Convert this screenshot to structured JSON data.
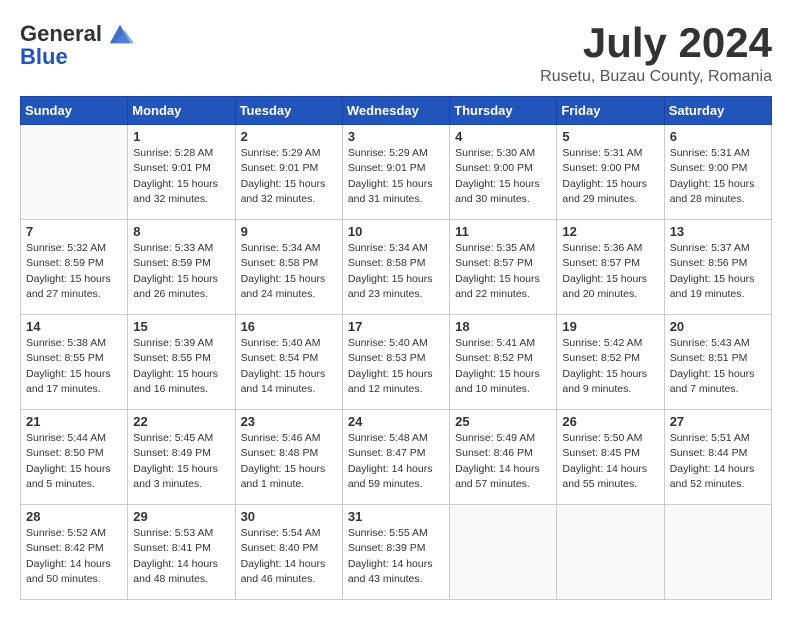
{
  "logo": {
    "general": "General",
    "blue": "Blue"
  },
  "title": "July 2024",
  "subtitle": "Rusetu, Buzau County, Romania",
  "weekdays": [
    "Sunday",
    "Monday",
    "Tuesday",
    "Wednesday",
    "Thursday",
    "Friday",
    "Saturday"
  ],
  "weeks": [
    [
      {
        "day": null,
        "info": null
      },
      {
        "day": "1",
        "sunrise": "5:28 AM",
        "sunset": "9:01 PM",
        "daylight": "15 hours and 32 minutes."
      },
      {
        "day": "2",
        "sunrise": "5:29 AM",
        "sunset": "9:01 PM",
        "daylight": "15 hours and 32 minutes."
      },
      {
        "day": "3",
        "sunrise": "5:29 AM",
        "sunset": "9:01 PM",
        "daylight": "15 hours and 31 minutes."
      },
      {
        "day": "4",
        "sunrise": "5:30 AM",
        "sunset": "9:00 PM",
        "daylight": "15 hours and 30 minutes."
      },
      {
        "day": "5",
        "sunrise": "5:31 AM",
        "sunset": "9:00 PM",
        "daylight": "15 hours and 29 minutes."
      },
      {
        "day": "6",
        "sunrise": "5:31 AM",
        "sunset": "9:00 PM",
        "daylight": "15 hours and 28 minutes."
      }
    ],
    [
      {
        "day": "7",
        "sunrise": "5:32 AM",
        "sunset": "8:59 PM",
        "daylight": "15 hours and 27 minutes."
      },
      {
        "day": "8",
        "sunrise": "5:33 AM",
        "sunset": "8:59 PM",
        "daylight": "15 hours and 26 minutes."
      },
      {
        "day": "9",
        "sunrise": "5:34 AM",
        "sunset": "8:58 PM",
        "daylight": "15 hours and 24 minutes."
      },
      {
        "day": "10",
        "sunrise": "5:34 AM",
        "sunset": "8:58 PM",
        "daylight": "15 hours and 23 minutes."
      },
      {
        "day": "11",
        "sunrise": "5:35 AM",
        "sunset": "8:57 PM",
        "daylight": "15 hours and 22 minutes."
      },
      {
        "day": "12",
        "sunrise": "5:36 AM",
        "sunset": "8:57 PM",
        "daylight": "15 hours and 20 minutes."
      },
      {
        "day": "13",
        "sunrise": "5:37 AM",
        "sunset": "8:56 PM",
        "daylight": "15 hours and 19 minutes."
      }
    ],
    [
      {
        "day": "14",
        "sunrise": "5:38 AM",
        "sunset": "8:55 PM",
        "daylight": "15 hours and 17 minutes."
      },
      {
        "day": "15",
        "sunrise": "5:39 AM",
        "sunset": "8:55 PM",
        "daylight": "15 hours and 16 minutes."
      },
      {
        "day": "16",
        "sunrise": "5:40 AM",
        "sunset": "8:54 PM",
        "daylight": "15 hours and 14 minutes."
      },
      {
        "day": "17",
        "sunrise": "5:40 AM",
        "sunset": "8:53 PM",
        "daylight": "15 hours and 12 minutes."
      },
      {
        "day": "18",
        "sunrise": "5:41 AM",
        "sunset": "8:52 PM",
        "daylight": "15 hours and 10 minutes."
      },
      {
        "day": "19",
        "sunrise": "5:42 AM",
        "sunset": "8:52 PM",
        "daylight": "15 hours and 9 minutes."
      },
      {
        "day": "20",
        "sunrise": "5:43 AM",
        "sunset": "8:51 PM",
        "daylight": "15 hours and 7 minutes."
      }
    ],
    [
      {
        "day": "21",
        "sunrise": "5:44 AM",
        "sunset": "8:50 PM",
        "daylight": "15 hours and 5 minutes."
      },
      {
        "day": "22",
        "sunrise": "5:45 AM",
        "sunset": "8:49 PM",
        "daylight": "15 hours and 3 minutes."
      },
      {
        "day": "23",
        "sunrise": "5:46 AM",
        "sunset": "8:48 PM",
        "daylight": "15 hours and 1 minute."
      },
      {
        "day": "24",
        "sunrise": "5:48 AM",
        "sunset": "8:47 PM",
        "daylight": "14 hours and 59 minutes."
      },
      {
        "day": "25",
        "sunrise": "5:49 AM",
        "sunset": "8:46 PM",
        "daylight": "14 hours and 57 minutes."
      },
      {
        "day": "26",
        "sunrise": "5:50 AM",
        "sunset": "8:45 PM",
        "daylight": "14 hours and 55 minutes."
      },
      {
        "day": "27",
        "sunrise": "5:51 AM",
        "sunset": "8:44 PM",
        "daylight": "14 hours and 52 minutes."
      }
    ],
    [
      {
        "day": "28",
        "sunrise": "5:52 AM",
        "sunset": "8:42 PM",
        "daylight": "14 hours and 50 minutes."
      },
      {
        "day": "29",
        "sunrise": "5:53 AM",
        "sunset": "8:41 PM",
        "daylight": "14 hours and 48 minutes."
      },
      {
        "day": "30",
        "sunrise": "5:54 AM",
        "sunset": "8:40 PM",
        "daylight": "14 hours and 46 minutes."
      },
      {
        "day": "31",
        "sunrise": "5:55 AM",
        "sunset": "8:39 PM",
        "daylight": "14 hours and 43 minutes."
      },
      {
        "day": null,
        "info": null
      },
      {
        "day": null,
        "info": null
      },
      {
        "day": null,
        "info": null
      }
    ]
  ]
}
